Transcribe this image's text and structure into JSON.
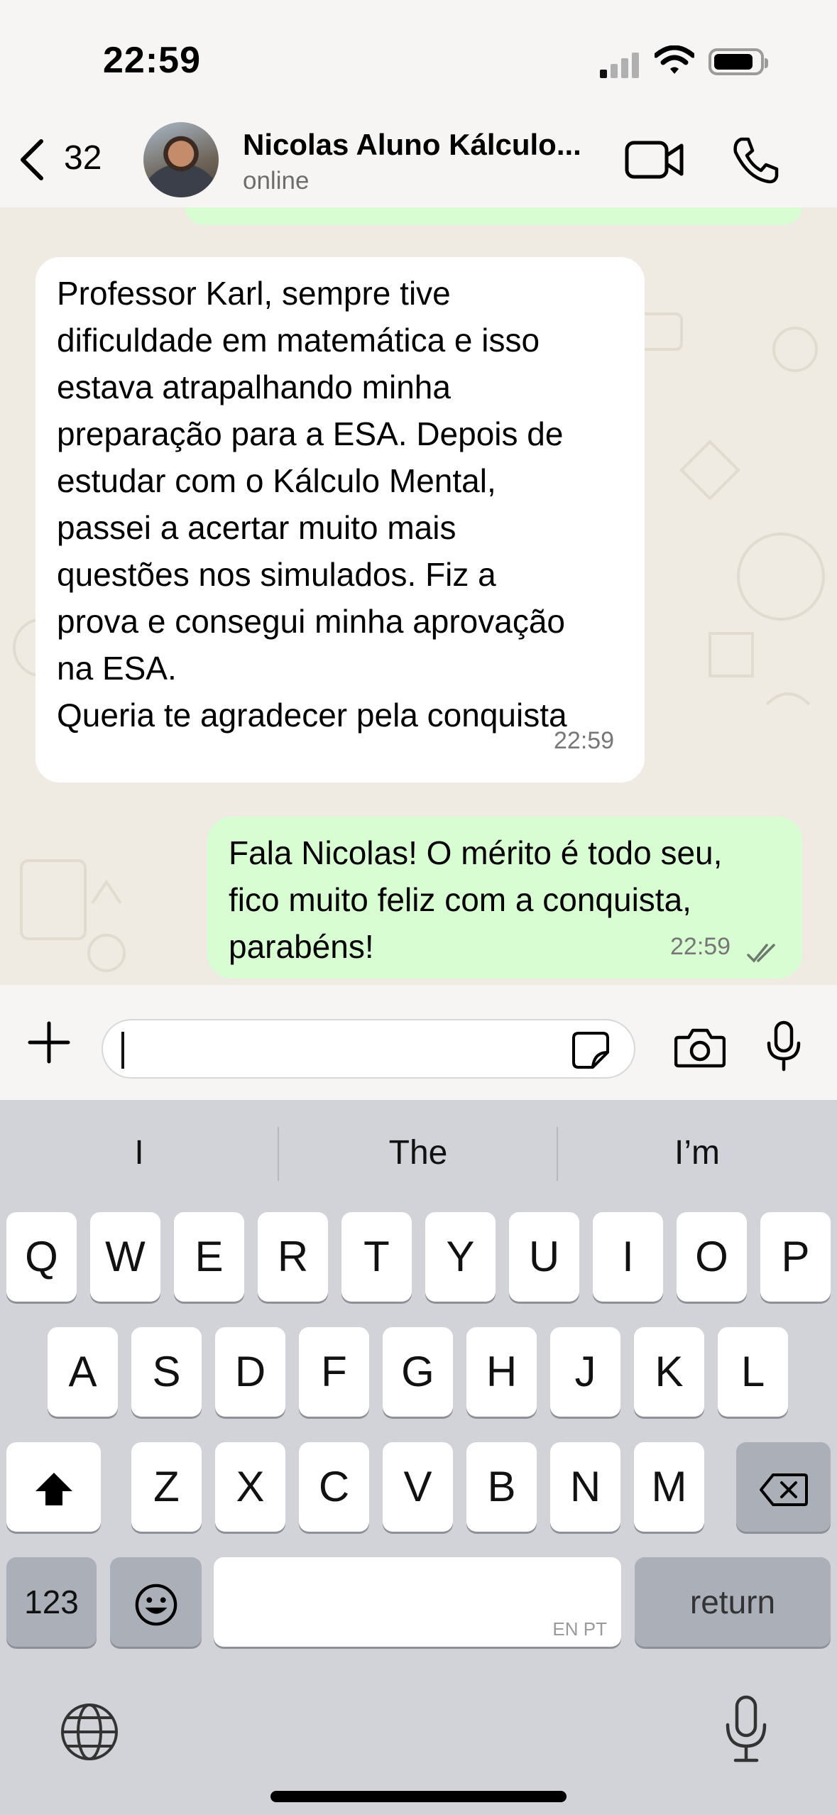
{
  "status_bar": {
    "time": "22:59"
  },
  "header": {
    "back_count": "32",
    "contact_name": "Nicolas Aluno Kálculo...",
    "contact_status": "online"
  },
  "messages": [
    {
      "direction": "incoming",
      "text": "Professor Karl, sempre tive\ndificuldade em matemática e isso\nestava atrapalhando minha\npreparação para a ESA. Depois de\nestudar com o Kálculo Mental,\npassei a acertar muito mais\nquestões nos simulados. Fiz a\nprova e consegui minha aprovação\nna ESA.\nQueria te agradecer pela conquista",
      "time": "22:59"
    },
    {
      "direction": "outgoing",
      "text": "Fala Nicolas! O mérito é todo seu,\nfico muito feliz com a conquista,\nparabéns!",
      "time": "22:59",
      "status": "read"
    }
  ],
  "composer": {
    "value": ""
  },
  "keyboard": {
    "suggestions": [
      "I",
      "The",
      "I’m"
    ],
    "row1": [
      "Q",
      "W",
      "E",
      "R",
      "T",
      "Y",
      "U",
      "I",
      "O",
      "P"
    ],
    "row2": [
      "A",
      "S",
      "D",
      "F",
      "G",
      "H",
      "J",
      "K",
      "L"
    ],
    "row3": [
      "Z",
      "X",
      "C",
      "V",
      "B",
      "N",
      "M"
    ],
    "numbers_key": "123",
    "return_key": "return",
    "space_hint": "EN PT"
  },
  "colors": {
    "outgoing_bubble": "#d9fdd3",
    "incoming_bubble": "#ffffff",
    "chat_bg": "#efeae2",
    "keyboard_bg": "#d1d3d9"
  }
}
